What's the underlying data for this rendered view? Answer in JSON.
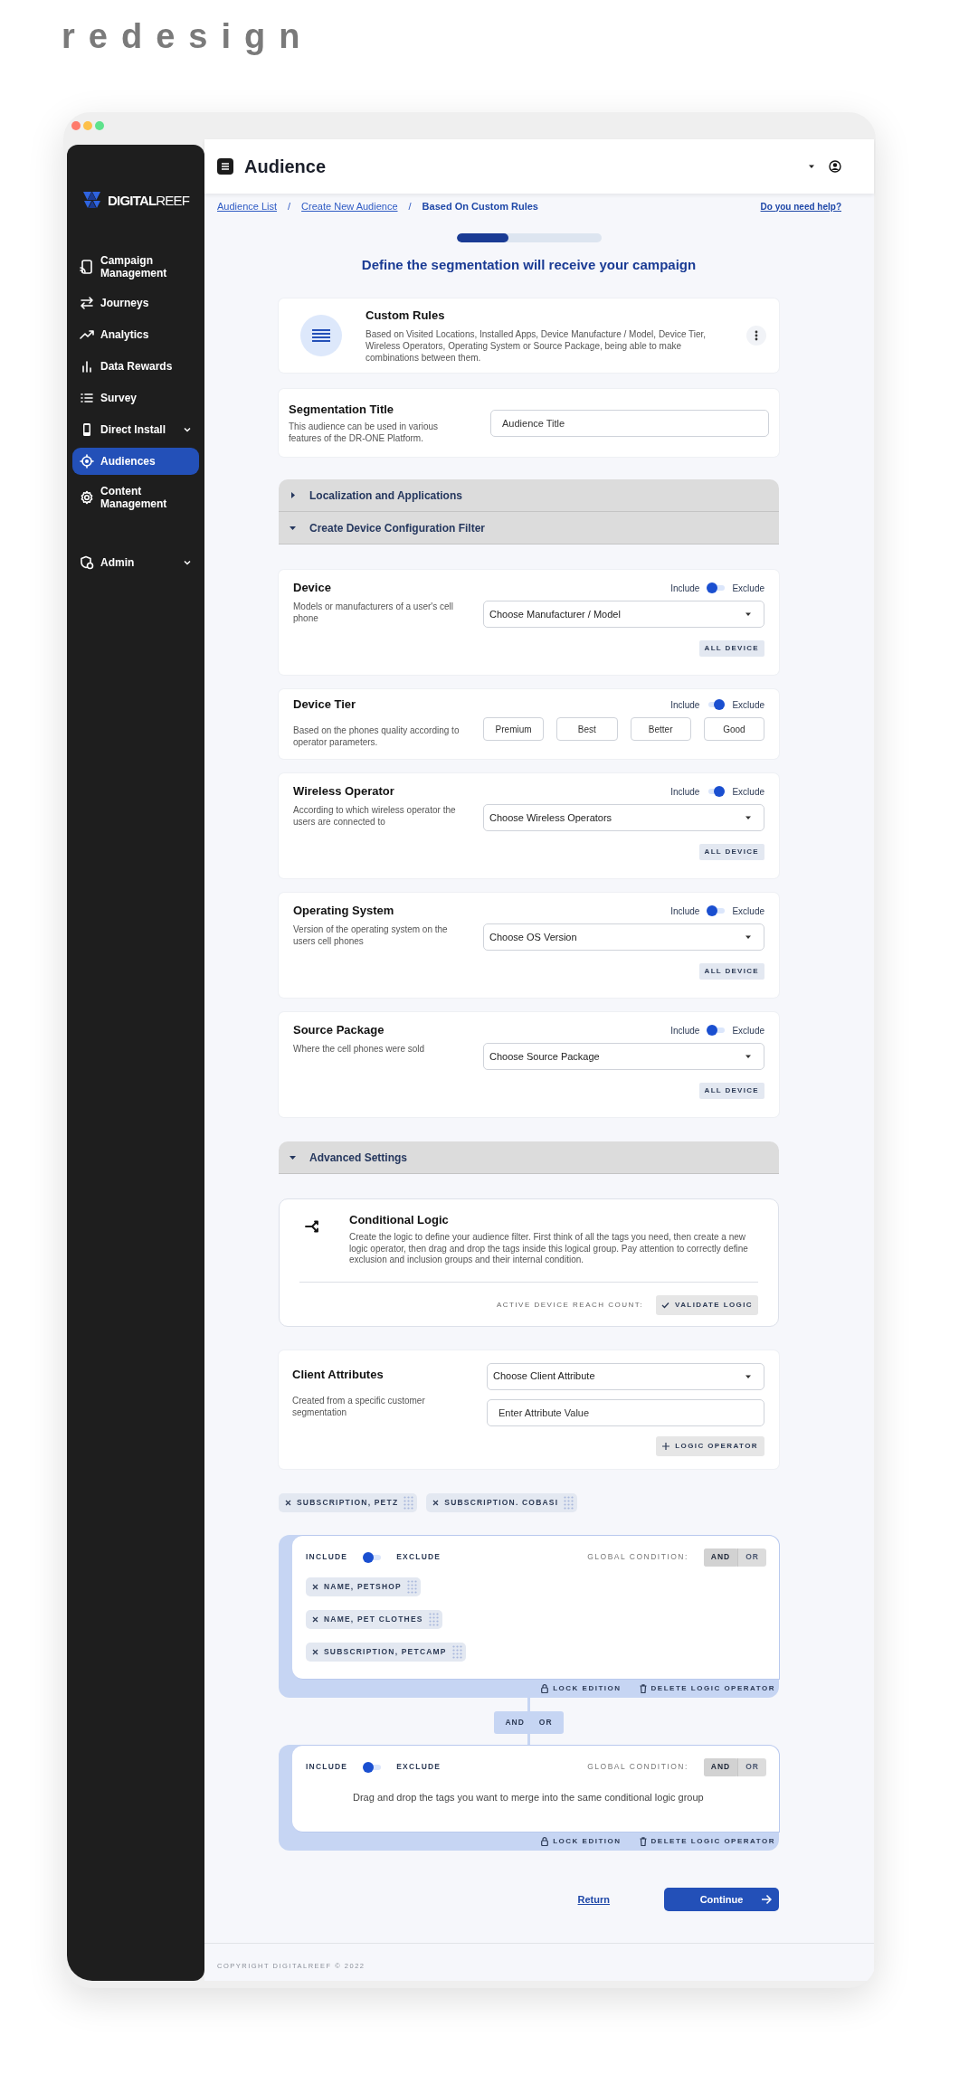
{
  "mockup_label": "redesign",
  "sidebar": {
    "logo": {
      "bold": "DIGITAL",
      "light": "REEF"
    },
    "items": [
      {
        "label": "Campaign Management",
        "kind": "link",
        "selected": false
      },
      {
        "label": "Journeys",
        "kind": "link",
        "selected": false
      },
      {
        "label": "Analytics",
        "kind": "link",
        "selected": false
      },
      {
        "label": "Data Rewards",
        "kind": "link",
        "selected": false
      },
      {
        "label": "Survey",
        "kind": "link",
        "selected": false
      },
      {
        "label": "Direct Install",
        "kind": "group",
        "selected": false
      },
      {
        "label": "Audiences",
        "kind": "link",
        "selected": true
      },
      {
        "label": "Content Management",
        "kind": "link",
        "selected": false
      }
    ],
    "bottom_items": [
      {
        "label": "Admin",
        "kind": "group",
        "selected": false
      }
    ]
  },
  "header": {
    "title": "Audience"
  },
  "breadcrumb": [
    {
      "label": "Audience List",
      "kind": "link"
    },
    {
      "label": "/",
      "kind": "separator"
    },
    {
      "label": "Create New Audience",
      "kind": "link"
    },
    {
      "label": "/",
      "kind": "separator"
    },
    {
      "label": "Based On Custom Rules",
      "kind": "current"
    }
  ],
  "help_link": "Do you need help?",
  "progress": {
    "level": 0.36
  },
  "heading": "Define the segmentation will receive your campaign",
  "rule_card": {
    "title": "Custom Rules",
    "description": "Based on Visited Locations, Installed Apps, Device Manufacture / Model, Device Tier, Wireless Operators, Operating System or Source Package, being able to make combinations between them."
  },
  "segmentation": {
    "title": "Segmentation Title",
    "description": "This audience can be used in various features of the DR-ONE Platform.",
    "placeholder": "Audience Title"
  },
  "sections": [
    {
      "label": "Localization and Applications",
      "expanded": false
    },
    {
      "label": "Create Device Configuration Filter",
      "expanded": true
    }
  ],
  "filters": [
    {
      "kind": "select",
      "title": "Device",
      "description": "Models or manufacturers of a user's cell phone",
      "include_label": "Include",
      "exclude_label": "Exclude",
      "exclude": false,
      "select": "Choose Manufacturer / Model",
      "badge": "ALL DEVICE"
    },
    {
      "kind": "buttons",
      "title": "Device Tier",
      "description": "Based on the phones quality according to operator parameters.",
      "include_label": "Include",
      "exclude_label": "Exclude",
      "exclude": true,
      "options": [
        "Premium",
        "Best",
        "Better",
        "Good"
      ]
    },
    {
      "kind": "select",
      "title": "Wireless Operator",
      "description": "According to which wireless operator the users are connected to",
      "include_label": "Include",
      "exclude_label": "Exclude",
      "exclude": true,
      "select": "Choose Wireless Operators",
      "badge": "ALL DEVICE"
    },
    {
      "kind": "select",
      "title": "Operating System",
      "description": "Version of the operating system on the users cell phones",
      "include_label": "Include",
      "exclude_label": "Exclude",
      "exclude": false,
      "select": "Choose OS Version",
      "badge": "ALL DEVICE"
    },
    {
      "kind": "select",
      "title": "Source Package",
      "description": "Where the cell phones were sold",
      "include_label": "Include",
      "exclude_label": "Exclude",
      "exclude": false,
      "select": "Choose Source Package",
      "badge": "ALL DEVICE"
    }
  ],
  "advanced": {
    "label": "Advanced Settings",
    "expanded": true
  },
  "conditional_logic": {
    "title": "Conditional Logic",
    "description": "Create the logic to define your audience filter. First think of all the tags you need, then create a new logic operator, then drag and drop the tags inside this logical group. Pay attention to correctly define exclusion and inclusion groups and their internal condition.",
    "reach_label": "ACTIVE DEVICE REACH COUNT:",
    "validate_button": "VALIDATE LOGIC"
  },
  "client_attributes": {
    "title": "Client Attributes",
    "description": "Created from a specific customer segmentation",
    "select": "Choose Client Attribute",
    "placeholder": "Enter Attribute Value",
    "add_button": "LOGIC OPERATOR"
  },
  "free_tags": [
    "SUBSCRIPTION, PETZ",
    "SUBSCRIPTION. COBASI"
  ],
  "logic_groups": [
    {
      "include_label": "INCLUDE",
      "exclude_label": "EXCLUDE",
      "exclude": false,
      "condition_label": "GLOBAL CONDITION:",
      "conditions": [
        {
          "label": "AND",
          "selected": true
        },
        {
          "label": "OR",
          "selected": false
        }
      ],
      "tags": [
        "NAME, PETSHOP",
        "NAME, PET CLOTHES",
        "SUBSCRIPTION, PETCAMP"
      ],
      "lock": "LOCK EDITION",
      "delete": "DELETE LOGIC OPERATOR"
    },
    {
      "include_label": "INCLUDE",
      "exclude_label": "EXCLUDE",
      "exclude": false,
      "condition_label": "GLOBAL CONDITION:",
      "conditions": [
        {
          "label": "AND",
          "selected": true
        },
        {
          "label": "OR",
          "selected": false
        }
      ],
      "hint": "Drag and drop the tags you want to merge into the same conditional logic group",
      "lock": "LOCK EDITION",
      "delete": "DELETE LOGIC OPERATOR"
    }
  ],
  "connector": [
    "AND",
    "OR"
  ],
  "actions": {
    "return": "Return",
    "continue": "Continue"
  },
  "footer": "COPYRIGHT DIGITALREEF © 2022"
}
